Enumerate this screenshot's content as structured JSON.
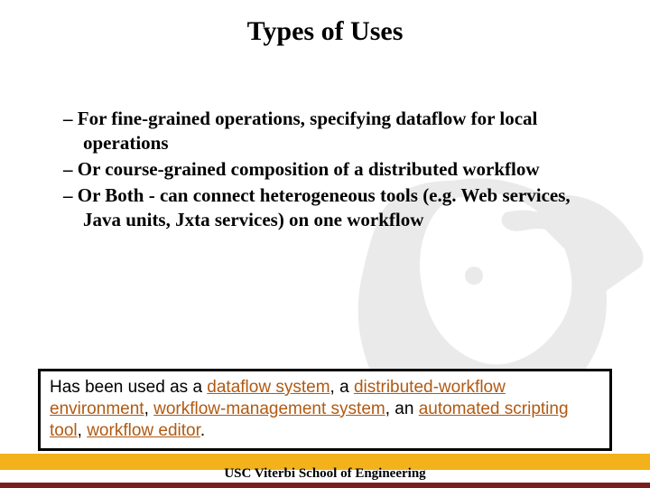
{
  "title": "Types of Uses",
  "bullets": {
    "b1": "For fine-grained operations, specifying dataflow for local operations",
    "b2": "Or course-grained composition of a distributed workflow",
    "b3": "Or Both - can connect heterogeneous tools (e.g. Web services, Java units, Jxta services) on one workflow"
  },
  "callout": {
    "t1": "Has been used as a ",
    "h1": "dataflow system",
    "t2": ", a ",
    "h2": "distributed-workflow environment",
    "t3": ", ",
    "h3": "workflow-management system",
    "t4": ", an ",
    "h4": "automated scripting tool",
    "t5": ", ",
    "h5": "workflow editor",
    "t6": "."
  },
  "footer": "USC Viterbi School of Engineering"
}
